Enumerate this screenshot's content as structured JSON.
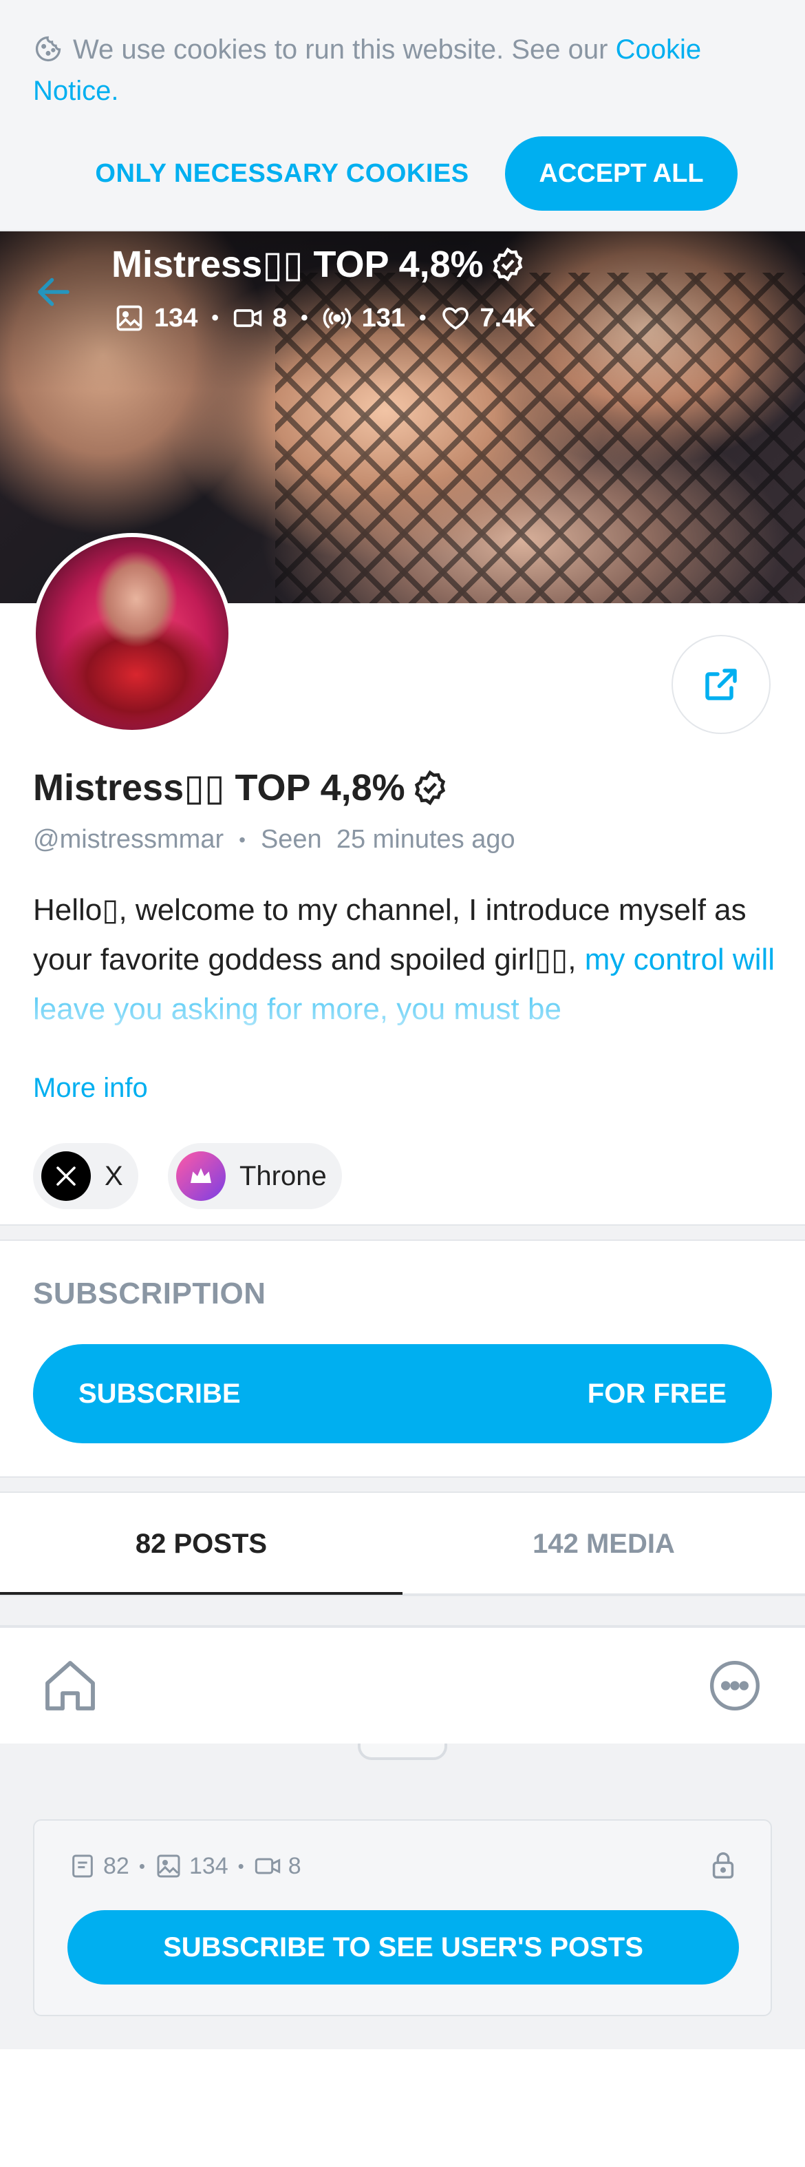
{
  "cookie_banner": {
    "text": "We use cookies to run this website. See our ",
    "link_text": "Cookie Notice",
    "period": ".",
    "necessary_label": "ONLY NECESSARY COOKIES",
    "accept_label": "ACCEPT ALL"
  },
  "header": {
    "title": "Mistress▯▯ TOP 4,8%",
    "stats": {
      "photos": "134",
      "videos": "8",
      "streams": "131",
      "likes": "7.4K"
    }
  },
  "profile": {
    "name": "Mistress▯▯ TOP 4,8%",
    "handle": "@mistressmmar",
    "seen_label": "Seen",
    "seen_time": "25 minutes ago",
    "bio_main": "Hello▯, welcome to my channel, I introduce myself as your favorite goddess and spoiled girl▯▯, ",
    "bio_link": "my control will leave you asking for more, you must be",
    "more_info": "More info",
    "socials": [
      {
        "label": "X",
        "icon": "x-logo-icon"
      },
      {
        "label": "Throne",
        "icon": "throne-logo-icon"
      }
    ]
  },
  "subscription": {
    "heading": "SUBSCRIPTION",
    "button_left": "SUBSCRIBE",
    "button_right": "FOR FREE"
  },
  "tabs": [
    {
      "label": "82 POSTS",
      "active": true
    },
    {
      "label": "142 MEDIA",
      "active": false
    }
  ],
  "locked": {
    "posts": "82",
    "photos": "134",
    "videos": "8",
    "button": "SUBSCRIBE TO SEE USER'S POSTS"
  },
  "colors": {
    "accent": "#00aff0",
    "muted": "#8a96a3",
    "text": "#222222",
    "panel": "#f1f2f4"
  }
}
